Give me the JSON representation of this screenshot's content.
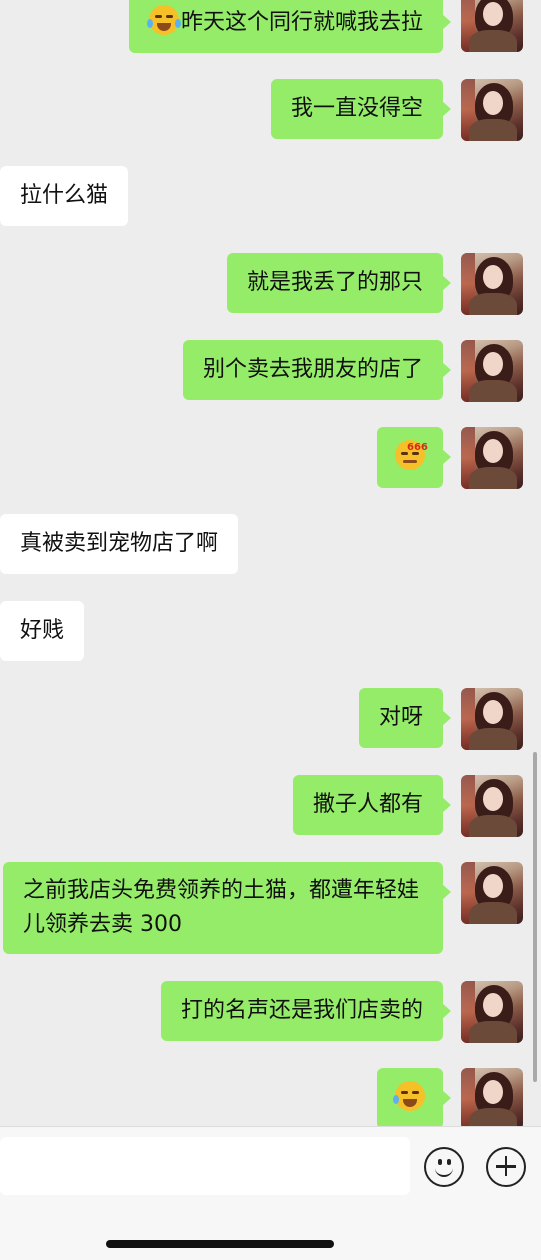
{
  "messages": [
    {
      "sender": "me",
      "text": "昨天这个同行就喊我去拉",
      "leading_emoji": "laughing-tears-emoji"
    },
    {
      "sender": "me",
      "text": "我一直没得空"
    },
    {
      "sender": "them",
      "text": "拉什么猫"
    },
    {
      "sender": "me",
      "text": "就是我丢了的那只"
    },
    {
      "sender": "me",
      "text": "别个卖去我朋友的店了"
    },
    {
      "sender": "me",
      "emoji": "666-emoji",
      "emoji_label": "666"
    },
    {
      "sender": "them",
      "text": "真被卖到宠物店了啊"
    },
    {
      "sender": "them",
      "text": "好贱"
    },
    {
      "sender": "me",
      "text": "对呀"
    },
    {
      "sender": "me",
      "text": "撒子人都有"
    },
    {
      "sender": "me",
      "text": "之前我店头免费领养的土猫，都遭年轻娃儿领养去卖 300"
    },
    {
      "sender": "me",
      "text": "打的名声还是我们店卖的"
    },
    {
      "sender": "me",
      "emoji": "crying-laughing-emoji"
    }
  ],
  "input_bar": {
    "input_value": "",
    "emoji_button": "smiley-icon",
    "more_button": "plus-icon"
  }
}
